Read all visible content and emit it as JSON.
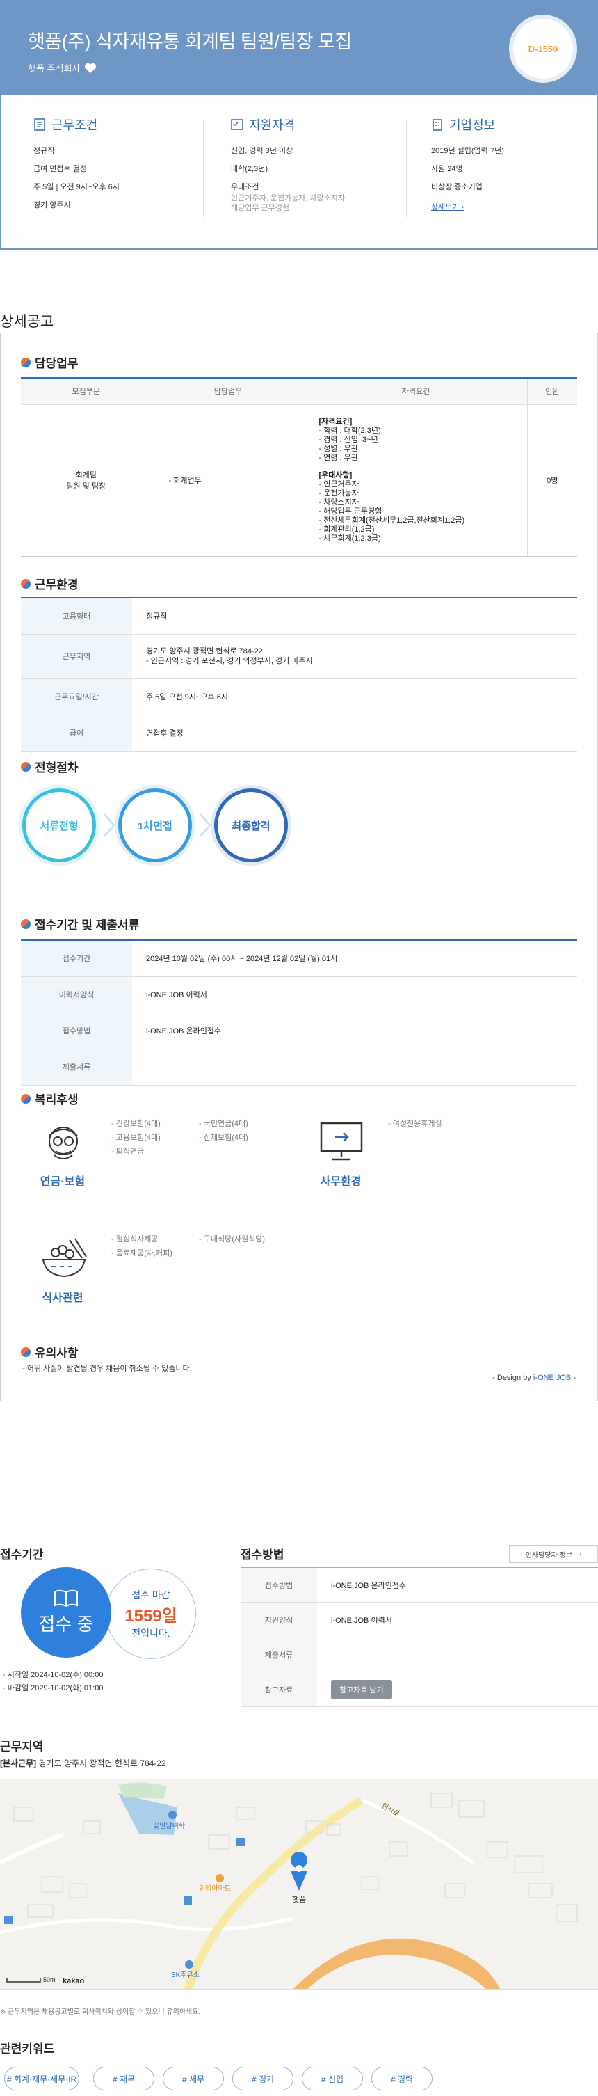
{
  "header": {
    "title": "햇품(주) 식자재유통 회계팀 팀원/팀장 모집",
    "company": "햇품 주식회사",
    "dday": "D-1559"
  },
  "summary": {
    "conditions": {
      "title": "근무조건",
      "items": [
        "정규직",
        "급여 면접후 결정",
        "주 5일 | 오전 9시~오후 6시",
        "경기 양주시"
      ]
    },
    "qualification": {
      "title": "지원자격",
      "items": [
        "신입, 경력 3년 이상",
        "대학(2,3년)",
        "우대조건"
      ],
      "extra": [
        "인근거주자, 운전가능자, 차량소지자,",
        "해당업무 근무경험"
      ]
    },
    "company": {
      "title": "기업정보",
      "items": [
        "2019년 설립(업력 7년)",
        "사원 24명",
        "비상장 중소기업"
      ],
      "link": "상세보기"
    }
  },
  "detail": {
    "section_title": "상세공고",
    "duty": {
      "title": "담당업무",
      "headers": [
        "모집부문",
        "담당업무",
        "자격요건",
        "인원"
      ],
      "row": {
        "part_line1": "회계팀",
        "part_line2": "팀원 및 팀장",
        "duty": "- 회계업무",
        "req_title": "[자격요건]",
        "req_items": [
          "- 학력 : 대학(2,3년)",
          "- 경력 : 신입, 3~년",
          "- 성별 : 무관",
          "- 연령 : 무관"
        ],
        "pref_title": "[우대사항]",
        "pref_items": [
          "- 인근거주자",
          "- 운전가능자",
          "- 차량소지자",
          "- 해당업무 근무경험",
          "- 전산세무회계(전산세무1,2급,전산회계1,2급)",
          "- 회계관리(1,2급)",
          "- 세무회계(1,2,3급)"
        ],
        "count": "0명"
      }
    },
    "environment": {
      "title": "근무환경",
      "rows": [
        {
          "k": "고용형태",
          "v": "정규직",
          "v2": ""
        },
        {
          "k": "근무지역",
          "v": "경기도 양주시 광적면 현석로 784-22",
          "v2": "- 인근지역 : 경기 포천시, 경기 의정부시, 경기 파주시"
        },
        {
          "k": "근무요일/시간",
          "v": "주 5일 오전 9시~오후 6시",
          "v2": ""
        },
        {
          "k": "급여",
          "v": "면접후 결정",
          "v2": ""
        }
      ]
    },
    "process": {
      "title": "전형절차",
      "steps": [
        "서류전형",
        "1차면접",
        "최종합격"
      ],
      "colors": [
        "#3cc0e0",
        "#3a9ce0",
        "#2e6ab3"
      ]
    },
    "period": {
      "title": "접수기간 및 제출서류",
      "rows": [
        {
          "k": "접수기간",
          "v": "2024년 10월 02일 (수) 00시 ~ 2024년 12월 02일 (월) 01시"
        },
        {
          "k": "이력서양식",
          "v": "i-ONE JOB 이력서"
        },
        {
          "k": "접수방법",
          "v": "i-ONE JOB 온라인접수"
        },
        {
          "k": "제출서류",
          "v": ""
        }
      ]
    },
    "welfare": {
      "title": "복리후생",
      "insurance": {
        "label": "연금·보험",
        "col1": [
          "- 건강보험(4대)",
          "- 고용보험(4대)",
          "- 퇴직연금"
        ],
        "col2": [
          "- 국민연금(4대)",
          "- 산재보험(4대)"
        ]
      },
      "office": {
        "label": "사무환경",
        "col1": [
          "- 여성전용휴게실"
        ]
      },
      "meal": {
        "label": "식사관련",
        "col1": [
          "- 점심식사제공",
          "- 음료제공(차,커피)"
        ],
        "col2": [
          "- 구내식당(사원식당)"
        ]
      }
    },
    "notice": {
      "title": "유의사항",
      "text": "- 허위 사실이 발견될 경우 채용이 취소될 수 있습니다.",
      "design_prefix": "- Design by ",
      "design_brand": "i-ONE JOB",
      "design_suffix": " -"
    }
  },
  "apply": {
    "period_title": "접수기간",
    "status": "접수 중",
    "deadline_label": "접수 마감",
    "deadline_days": "1559일",
    "deadline_suffix": "전입니다.",
    "start": "시작일 2024-10-02(수) 00:00",
    "end": "마감일 2029-10-02(화) 01:00",
    "method_title": "접수방법",
    "hr_button": "인사담당자 정보",
    "rows": [
      {
        "k": "접수방법",
        "v": "i-ONE JOB 온라인접수"
      },
      {
        "k": "지원양식",
        "v": "i-ONE JOB 이력서"
      },
      {
        "k": "제출서류",
        "v": ""
      },
      {
        "k": "참고자료",
        "v": ""
      }
    ],
    "ref_button": "참고자료 받기"
  },
  "location": {
    "title": "근무지역",
    "label": "[본사근무]",
    "address": "경기도 양주시 광적면 현석로 784-22",
    "map_labels": {
      "pin": "햇품",
      "mart": "원티아마트",
      "school": "꽃말남녀학",
      "station": "SK주유소",
      "road": "현석로",
      "scale": "50m",
      "brand": "kakao"
    },
    "note": "※ 근무지역은 채용공고별로 회사위치와 상이할 수 있으니 유의하세요."
  },
  "keywords": {
    "title": "관련키워드",
    "items": [
      "# 회계·재무·세무·IR",
      "# 재무",
      "# 세무",
      "# 경기",
      "# 신입",
      "# 경력"
    ]
  },
  "colors": {
    "brand": "#6f97c6",
    "accent": "#2e6ab3",
    "dday": "#f0a243",
    "deadline": "#e85a28"
  }
}
